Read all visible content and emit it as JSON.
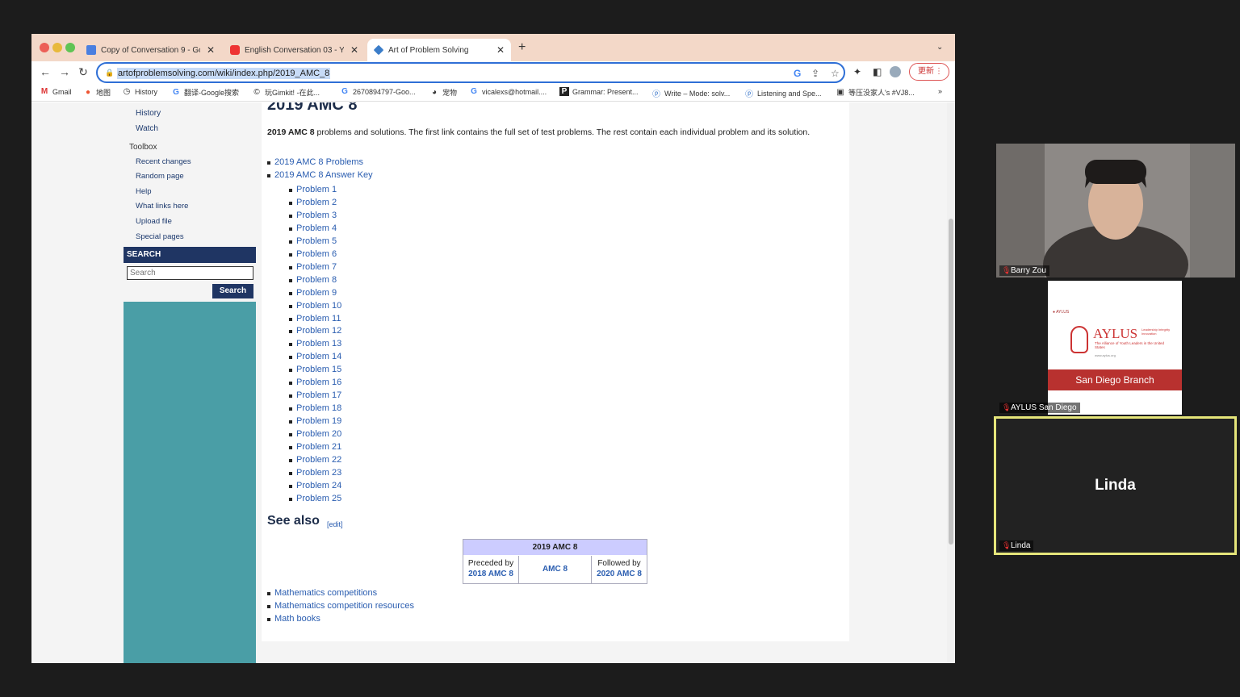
{
  "browser": {
    "tabs": [
      {
        "label": "Copy of Conversation 9 - Goog",
        "icon": "docs-icon",
        "color": "#4a7fe0"
      },
      {
        "label": "English Conversation 03 - YouT",
        "icon": "youtube-icon",
        "color": "#e33"
      },
      {
        "label": "Art of Problem Solving",
        "icon": "aops-icon",
        "color": "#3b7dc9"
      }
    ],
    "new_tab": "+",
    "close": "✕",
    "url": "artofproblemsolving.com/wiki/index.php/2019_AMC_8",
    "update_label": "更新",
    "bookmarks": [
      {
        "label": "Gmail",
        "icon": "gmail-icon"
      },
      {
        "label": "地图",
        "icon": "maps-icon"
      },
      {
        "label": "History",
        "icon": "history-icon"
      },
      {
        "label": "翻译-Google搜索",
        "icon": "google-icon"
      },
      {
        "label": "玩Gimkit! -在此...",
        "icon": "gimkit-icon"
      },
      {
        "label": "2670894797-Goo...",
        "icon": "google-icon"
      },
      {
        "label": "宠物",
        "icon": "pet-icon"
      },
      {
        "label": "vicalexs@hotmail....",
        "icon": "google-icon"
      },
      {
        "label": "Grammar: Present...",
        "icon": "p-icon"
      },
      {
        "label": "Write – Mode: solv...",
        "icon": "write-icon"
      },
      {
        "label": "Listening and Spe...",
        "icon": "listen-icon"
      },
      {
        "label": "等压没家人's #VJ8...",
        "icon": "site-icon"
      }
    ],
    "bookmarks_more": "»"
  },
  "sidebar": {
    "links_top": [
      "History",
      "Watch"
    ],
    "toolbox_heading": "Toolbox",
    "toolbox_links": [
      "Recent changes",
      "Random page",
      "Help",
      "What links here",
      "Upload file",
      "Special pages"
    ],
    "search_heading": "SEARCH",
    "search_placeholder": "Search",
    "search_button": "Search"
  },
  "article": {
    "title": "2019 AMC 8",
    "intro_bold": "2019 AMC 8",
    "intro_rest": " problems and solutions. The first link contains the full set of test problems. The rest contain each individual problem and its solution.",
    "top_links": [
      "2019 AMC 8 Problems",
      "2019 AMC 8 Answer Key"
    ],
    "problems": [
      "Problem 1",
      "Problem 2",
      "Problem 3",
      "Problem 4",
      "Problem 5",
      "Problem 6",
      "Problem 7",
      "Problem 8",
      "Problem 9",
      "Problem 10",
      "Problem 11",
      "Problem 12",
      "Problem 13",
      "Problem 14",
      "Problem 15",
      "Problem 16",
      "Problem 17",
      "Problem 18",
      "Problem 19",
      "Problem 20",
      "Problem 21",
      "Problem 22",
      "Problem 23",
      "Problem 24",
      "Problem 25"
    ],
    "see_also": "See also",
    "edit": "[edit]",
    "navbox": {
      "title": "2019 AMC 8",
      "preceded_label": "Preceded by",
      "preceded_link": "2018 AMC 8",
      "center": "AMC 8",
      "followed_label": "Followed by",
      "followed_link": "2020 AMC 8"
    },
    "related": [
      "Mathematics competitions",
      "Mathematics competition resources",
      "Math books"
    ]
  },
  "meeting": {
    "participants": [
      {
        "name": "Barry Zou"
      },
      {
        "name": "AYLUS San Diego",
        "logo_text": "AYLUS",
        "logo_sub": "The Alliance of Youth Leaders in the United States",
        "logo_url": "www.aylus.org",
        "logo_small": "AYLUS",
        "logo_tag": "Leadership Integrity Innovation",
        "branch": "San Diego Branch"
      },
      {
        "name": "Linda",
        "big": "Linda"
      }
    ]
  }
}
